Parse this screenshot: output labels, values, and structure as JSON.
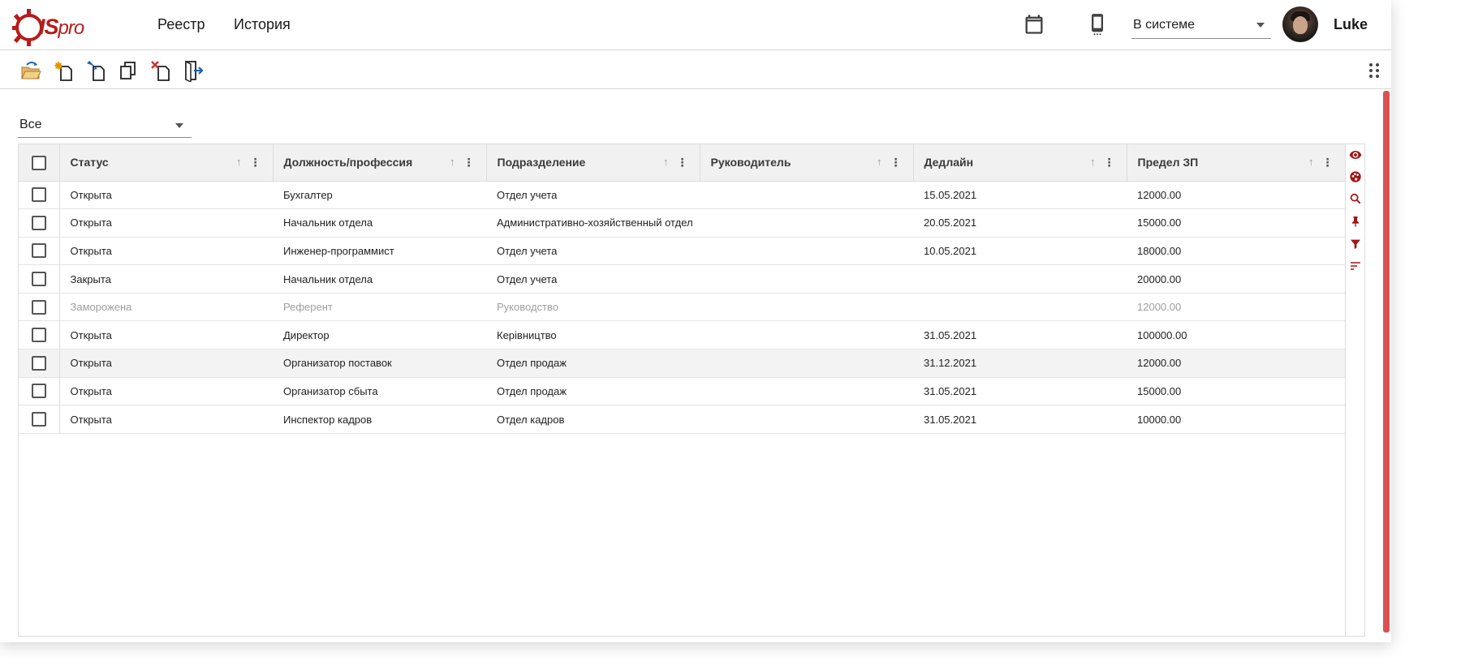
{
  "header": {
    "logo_text": "ISpro",
    "logo_main": "IS",
    "logo_sub": "pro",
    "nav": [
      {
        "label": "Реестр"
      },
      {
        "label": "История"
      }
    ],
    "status_value": "В системе",
    "username": "Luke"
  },
  "toolbar": {
    "buttons": [
      {
        "icon": "open-folder-icon"
      },
      {
        "icon": "new-document-icon"
      },
      {
        "icon": "edit-document-icon"
      },
      {
        "icon": "copy-document-icon"
      },
      {
        "icon": "delete-document-icon"
      },
      {
        "icon": "exit-icon"
      }
    ]
  },
  "filter": {
    "value": "Все"
  },
  "table": {
    "columns": [
      {
        "label": "Статус"
      },
      {
        "label": "Должность/профессия"
      },
      {
        "label": "Подразделение"
      },
      {
        "label": "Руководитель"
      },
      {
        "label": "Дедлайн"
      },
      {
        "label": "Предел ЗП"
      }
    ],
    "sort_glyph": "↑",
    "menu_glyph": "⋮",
    "rows": [
      {
        "status": "Открыта",
        "position": "Бухгалтер",
        "department": "Отдел учета",
        "manager": "",
        "deadline": "15.05.2021",
        "salary": "12000.00"
      },
      {
        "status": "Открыта",
        "position": "Начальник отдела",
        "department": "Административно-хозяйственный отдел",
        "manager": "",
        "deadline": "20.05.2021",
        "salary": "15000.00"
      },
      {
        "status": "Открыта",
        "position": "Инженер-программист",
        "department": "Отдел учета",
        "manager": "",
        "deadline": "10.05.2021",
        "salary": "18000.00"
      },
      {
        "status": "Закрыта",
        "position": "Начальник отдела",
        "department": "Отдел учета",
        "manager": "",
        "deadline": "",
        "salary": "20000.00"
      },
      {
        "status": "Заморожена",
        "position": "Референт",
        "department": "Руководство",
        "manager": "",
        "deadline": "",
        "salary": "12000.00"
      },
      {
        "status": "Открыта",
        "position": "Директор",
        "department": "Керівництво",
        "manager": "",
        "deadline": "31.05.2021",
        "salary": "100000.00"
      },
      {
        "status": "Открыта",
        "position": "Организатор поставок",
        "department": "Отдел продаж",
        "manager": "",
        "deadline": "31.12.2021",
        "salary": "12000.00"
      },
      {
        "status": "Открыта",
        "position": "Организатор сбыта",
        "department": "Отдел продаж",
        "manager": "",
        "deadline": "31.05.2021",
        "salary": "15000.00"
      },
      {
        "status": "Открыта",
        "position": "Инспектор кадров",
        "department": "Отдел кадров",
        "manager": "",
        "deadline": "31.05.2021",
        "salary": "10000.00"
      }
    ]
  },
  "side_panel": {
    "icons": [
      "eye-icon",
      "palette-icon",
      "search-icon",
      "pin-icon",
      "filter-icon",
      "sort-lines-icon"
    ]
  },
  "colors": {
    "accent": "#b71c1c",
    "scrollbar": "#d95252",
    "header_bg": "#f1f1f1"
  }
}
